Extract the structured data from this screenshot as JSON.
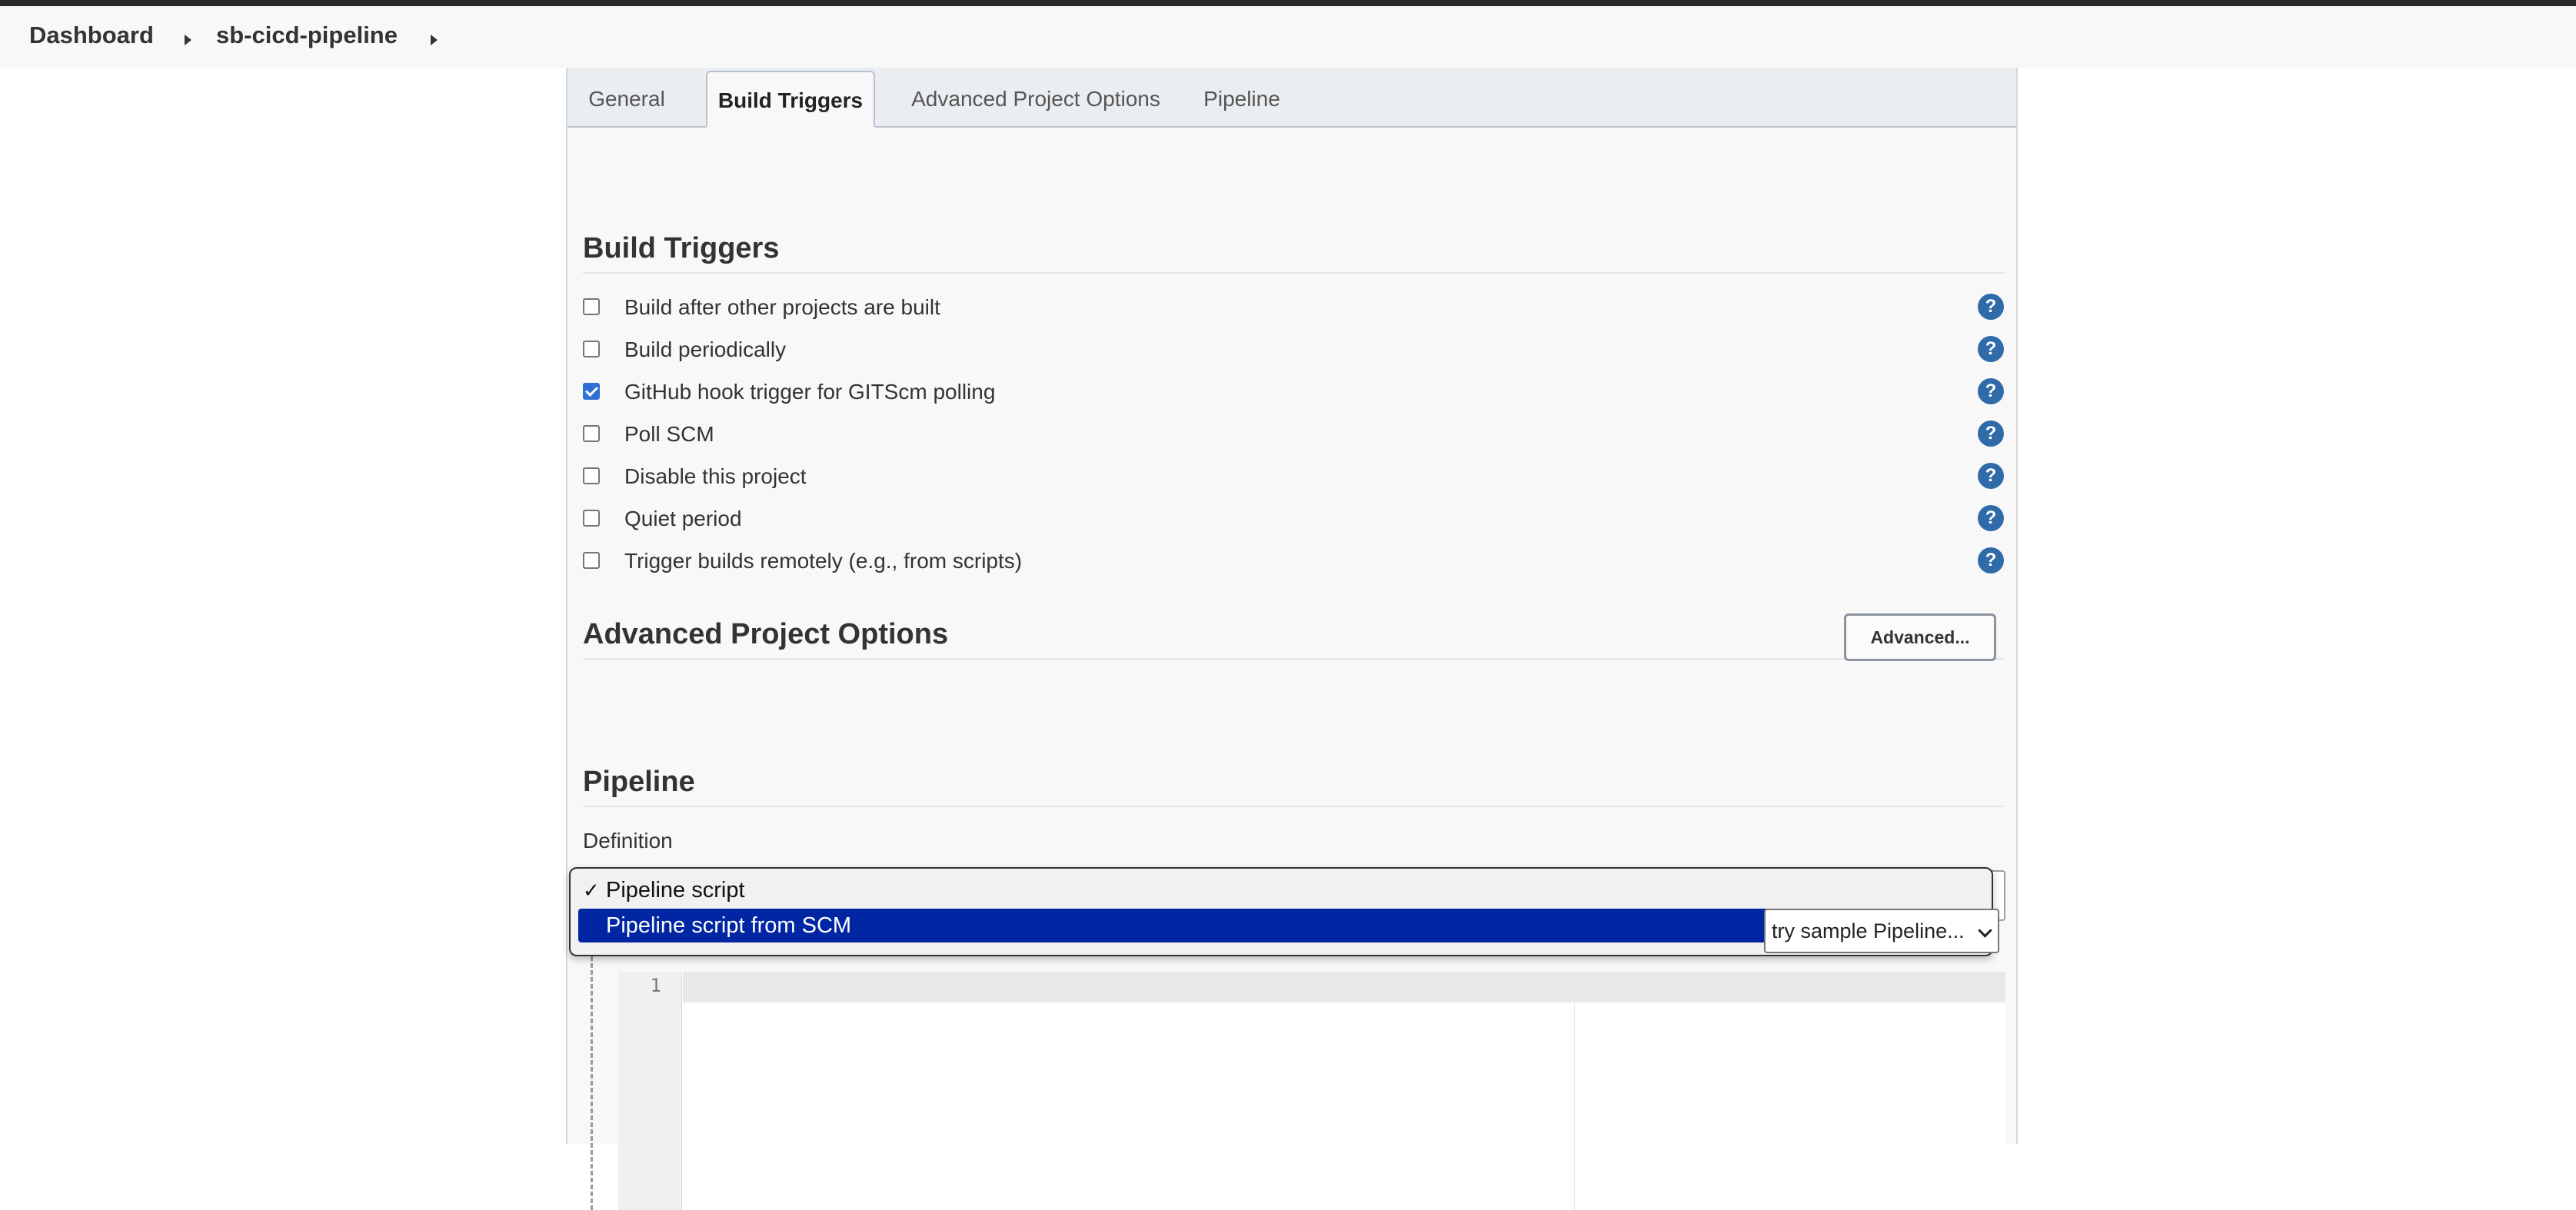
{
  "breadcrumb": {
    "items": [
      "Dashboard",
      "sb-cicd-pipeline"
    ]
  },
  "tabs": [
    {
      "label": "General",
      "active": false
    },
    {
      "label": "Build Triggers",
      "active": true
    },
    {
      "label": "Advanced Project Options",
      "active": false
    },
    {
      "label": "Pipeline",
      "active": false
    }
  ],
  "build_triggers": {
    "title": "Build Triggers",
    "options": [
      {
        "label": "Build after other projects are built",
        "checked": false
      },
      {
        "label": "Build periodically",
        "checked": false
      },
      {
        "label": "GitHub hook trigger for GITScm polling",
        "checked": true
      },
      {
        "label": "Poll SCM",
        "checked": false
      },
      {
        "label": "Disable this project",
        "checked": false
      },
      {
        "label": "Quiet period",
        "checked": false
      },
      {
        "label": "Trigger builds remotely (e.g., from scripts)",
        "checked": false
      }
    ],
    "help_glyph": "?"
  },
  "advanced_options": {
    "title": "Advanced Project Options",
    "button_label": "Advanced..."
  },
  "pipeline": {
    "title": "Pipeline",
    "definition_label": "Definition",
    "definition_options": [
      {
        "label": "Pipeline script",
        "selected": true
      },
      {
        "label": "Pipeline script from SCM",
        "highlighted": true
      }
    ],
    "check_glyph": "✓",
    "editor_line_number": "1",
    "sample_select_value": "try sample Pipeline..."
  },
  "colors": {
    "checkbox_checked": "#2f6fd6",
    "help_icon": "#2f6aa9",
    "dropdown_highlight": "#0026a3"
  }
}
